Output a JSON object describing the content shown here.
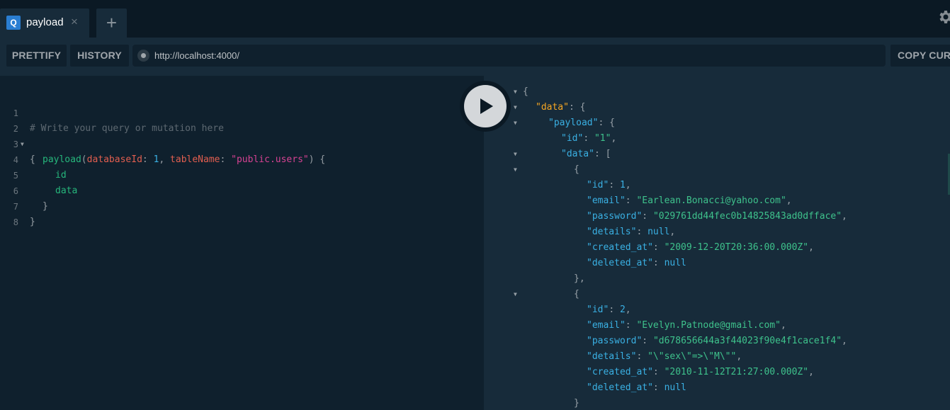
{
  "tab": {
    "badge": "Q",
    "title": "payload",
    "close": "×",
    "add": "+"
  },
  "toolbar": {
    "prettify_label": "PRETTIFY",
    "history_label": "HISTORY",
    "endpoint_url": "http://localhost:4000/",
    "copy_curl_label": "COPY CURL"
  },
  "query": {
    "lines": [
      {
        "num": "1",
        "text": "# Write your query or mutation here"
      },
      {
        "num": "2",
        "text": "{"
      },
      {
        "num": "3",
        "text": "payload(databaseId: 1, tableName: \"public.users\") {"
      },
      {
        "num": "4",
        "text": "id"
      },
      {
        "num": "5",
        "text": "data"
      },
      {
        "num": "6",
        "text": "}"
      },
      {
        "num": "7",
        "text": "}"
      },
      {
        "num": "8",
        "text": ""
      }
    ],
    "field_name": "payload",
    "arg1_name": "databaseId",
    "arg1_value": "1",
    "arg2_name": "tableName",
    "arg2_value": "\"public.users\""
  },
  "result": {
    "lines": [
      "{",
      "\"data\": {",
      "\"payload\": {",
      "\"id\": \"1\",",
      "\"data\": [",
      "{",
      "\"id\": 1,",
      "\"email\": \"Earlean.Bonacci@yahoo.com\",",
      "\"password\": \"029761dd44fec0b14825843ad0dfface\",",
      "\"details\": null,",
      "\"created_at\": \"2009-12-20T20:36:00.000Z\",",
      "\"deleted_at\": null",
      "},",
      "{",
      "\"id\": 2,",
      "\"email\": \"Evelyn.Patnode@gmail.com\",",
      "\"password\": \"d678656644a3f44023f90e4f1cace1f4\",",
      "\"details\": \"\\\"sex\\\"=>\\\"M\\\"\",",
      "\"created_at\": \"2010-11-12T21:27:00.000Z\",",
      "\"deleted_at\": null",
      "}"
    ]
  },
  "icons": {
    "execute": "play-icon",
    "settings": "gear-icon"
  },
  "colors": {
    "background": "#0f202d",
    "result_background": "#172b3a",
    "field": "#26b77c",
    "argument": "#e15e4f",
    "string": "#d64292",
    "key": "#3ab0e3",
    "data_key": "#f5a623",
    "result_string": "#3ec28c"
  }
}
